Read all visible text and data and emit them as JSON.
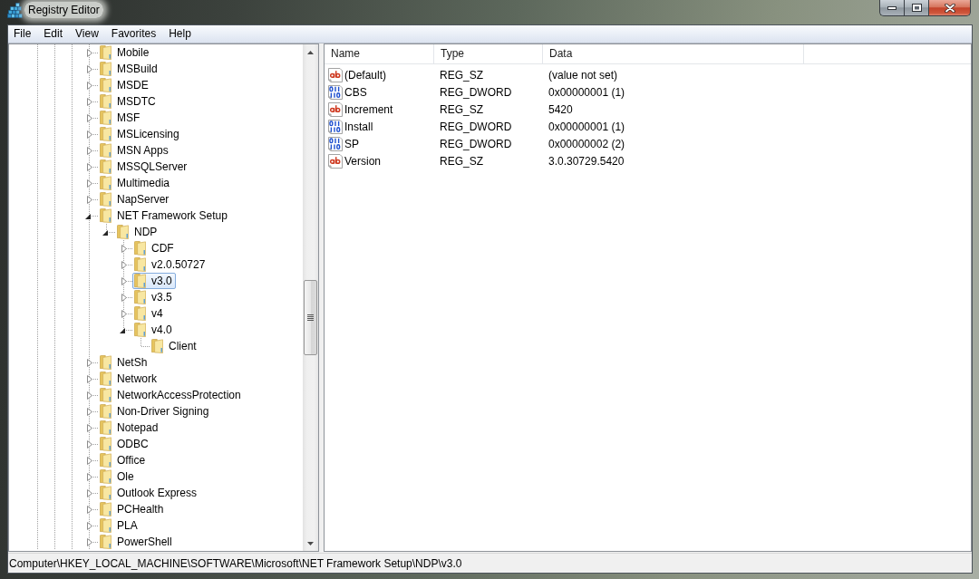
{
  "window": {
    "title": "Registry Editor"
  },
  "menu": [
    "File",
    "Edit",
    "View",
    "Favorites",
    "Help"
  ],
  "tree": {
    "items": [
      {
        "label": "Mobile",
        "expandable": true,
        "expanded": false,
        "selected": false
      },
      {
        "label": "MSBuild",
        "expandable": true,
        "expanded": false,
        "selected": false
      },
      {
        "label": "MSDE",
        "expandable": true,
        "expanded": false,
        "selected": false
      },
      {
        "label": "MSDTC",
        "expandable": true,
        "expanded": false,
        "selected": false
      },
      {
        "label": "MSF",
        "expandable": true,
        "expanded": false,
        "selected": false
      },
      {
        "label": "MSLicensing",
        "expandable": true,
        "expanded": false,
        "selected": false
      },
      {
        "label": "MSN Apps",
        "expandable": true,
        "expanded": false,
        "selected": false
      },
      {
        "label": "MSSQLServer",
        "expandable": true,
        "expanded": false,
        "selected": false
      },
      {
        "label": "Multimedia",
        "expandable": true,
        "expanded": false,
        "selected": false
      },
      {
        "label": "NapServer",
        "expandable": true,
        "expanded": false,
        "selected": false
      },
      {
        "label": "NET Framework Setup",
        "expandable": true,
        "expanded": true,
        "selected": false,
        "children": [
          {
            "label": "NDP",
            "expandable": true,
            "expanded": true,
            "selected": false,
            "children": [
              {
                "label": "CDF",
                "expandable": true,
                "expanded": false,
                "selected": false
              },
              {
                "label": "v2.0.50727",
                "expandable": true,
                "expanded": false,
                "selected": false
              },
              {
                "label": "v3.0",
                "expandable": true,
                "expanded": false,
                "selected": true
              },
              {
                "label": "v3.5",
                "expandable": true,
                "expanded": false,
                "selected": false
              },
              {
                "label": "v4",
                "expandable": true,
                "expanded": false,
                "selected": false
              },
              {
                "label": "v4.0",
                "expandable": true,
                "expanded": true,
                "selected": false,
                "children": [
                  {
                    "label": "Client",
                    "expandable": false,
                    "selected": false
                  }
                ]
              }
            ]
          }
        ]
      },
      {
        "label": "NetSh",
        "expandable": true,
        "expanded": false,
        "selected": false
      },
      {
        "label": "Network",
        "expandable": true,
        "expanded": false,
        "selected": false
      },
      {
        "label": "NetworkAccessProtection",
        "expandable": true,
        "expanded": false,
        "selected": false
      },
      {
        "label": "Non-Driver Signing",
        "expandable": true,
        "expanded": false,
        "selected": false
      },
      {
        "label": "Notepad",
        "expandable": true,
        "expanded": false,
        "selected": false
      },
      {
        "label": "ODBC",
        "expandable": true,
        "expanded": false,
        "selected": false
      },
      {
        "label": "Office",
        "expandable": true,
        "expanded": false,
        "selected": false
      },
      {
        "label": "Ole",
        "expandable": true,
        "expanded": false,
        "selected": false
      },
      {
        "label": "Outlook Express",
        "expandable": true,
        "expanded": false,
        "selected": false
      },
      {
        "label": "PCHealth",
        "expandable": true,
        "expanded": false,
        "selected": false
      },
      {
        "label": "PLA",
        "expandable": true,
        "expanded": false,
        "selected": false
      },
      {
        "label": "PowerShell",
        "expandable": true,
        "expanded": false,
        "selected": false
      }
    ]
  },
  "values": {
    "columns": [
      "Name",
      "Type",
      "Data"
    ],
    "rows": [
      {
        "kind": "string",
        "name": "(Default)",
        "type": "REG_SZ",
        "data": "(value not set)"
      },
      {
        "kind": "binary",
        "name": "CBS",
        "type": "REG_DWORD",
        "data": "0x00000001 (1)"
      },
      {
        "kind": "string",
        "name": "Increment",
        "type": "REG_SZ",
        "data": "5420"
      },
      {
        "kind": "binary",
        "name": "Install",
        "type": "REG_DWORD",
        "data": "0x00000001 (1)"
      },
      {
        "kind": "binary",
        "name": "SP",
        "type": "REG_DWORD",
        "data": "0x00000002 (2)"
      },
      {
        "kind": "string",
        "name": "Version",
        "type": "REG_SZ",
        "data": "3.0.30729.5420"
      }
    ]
  },
  "status_bar": "Computer\\HKEY_LOCAL_MACHINE\\SOFTWARE\\Microsoft\\NET Framework Setup\\NDP\\v3.0"
}
